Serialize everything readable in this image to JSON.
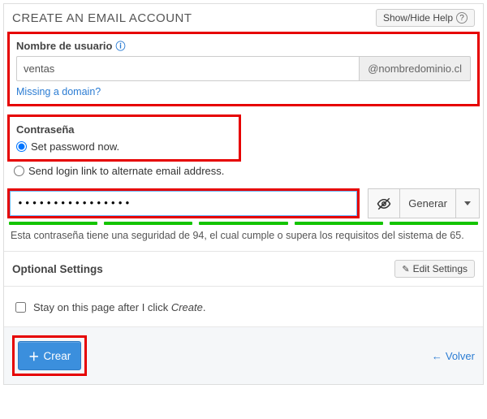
{
  "header": {
    "title": "CREATE AN EMAIL ACCOUNT",
    "help_label": "Show/Hide Help"
  },
  "username": {
    "label": "Nombre de usuario",
    "value": "ventas",
    "domain": "@nombredominio.cl",
    "missing_link": "Missing a domain?"
  },
  "password": {
    "label": "Contraseña",
    "opt_now": "Set password now.",
    "opt_link": "Send login link to alternate email address.",
    "value": "••••••••••••••••",
    "generate": "Generar",
    "strength_text": "Esta contraseña tiene una seguridad de 94, el cual cumple o supera los requisitos del sistema de 65."
  },
  "optional": {
    "title": "Optional Settings",
    "edit": "Edit Settings"
  },
  "stay": {
    "prefix": "Stay on this page after I click ",
    "em": "Create",
    "suffix": "."
  },
  "footer": {
    "create": "Crear",
    "back": "Volver"
  }
}
